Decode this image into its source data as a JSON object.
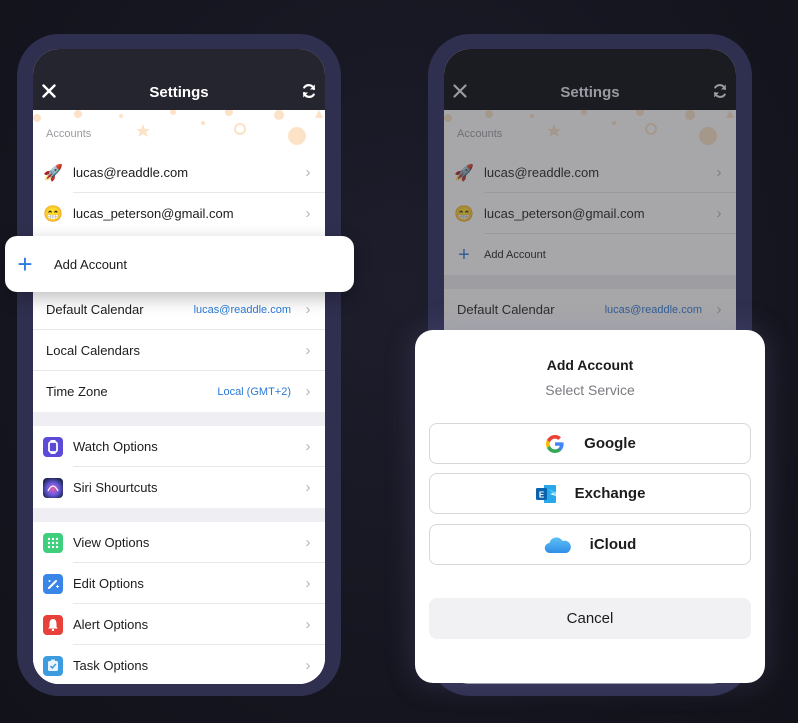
{
  "left_phone": {
    "nav": {
      "title": "Settings",
      "close_icon": "close-icon",
      "sync_icon": "sync-icon"
    },
    "accounts_section_label": "Accounts",
    "accounts": [
      {
        "icon": "rocket-emoji",
        "glyph": "🚀",
        "email": "lucas@readdle.com"
      },
      {
        "icon": "grinning-face-emoji",
        "glyph": "😁",
        "email": "lucas_peterson@gmail.com"
      }
    ],
    "add_account_card": {
      "label": "Add Account",
      "icon": "plus-icon"
    },
    "calendar_rows": [
      {
        "label": "Default Calendar",
        "value": "lucas@readdle.com"
      },
      {
        "label": "Local Calendars",
        "value": ""
      },
      {
        "label": "Time Zone",
        "value": "Local (GMT+2)"
      }
    ],
    "integrations": [
      {
        "label": "Watch Options",
        "icon": "watch-icon",
        "color": "#5b4bd6"
      },
      {
        "label": "Siri Shourtcuts",
        "icon": "siri-icon",
        "color": "#2a2f6b"
      }
    ],
    "options": [
      {
        "label": "View Options",
        "icon": "grid-icon",
        "color": "#3ecf7c"
      },
      {
        "label": "Edit Options",
        "icon": "pencil-icon",
        "color": "#3a86e8"
      },
      {
        "label": "Alert Options",
        "icon": "bell-icon",
        "color": "#e8403a"
      },
      {
        "label": "Task Options",
        "icon": "checklist-icon",
        "color": "#3d9be0"
      }
    ]
  },
  "right_phone": {
    "nav": {
      "title": "Settings"
    },
    "accounts_section_label": "Accounts",
    "accounts": [
      {
        "glyph": "🚀",
        "email": "lucas@readdle.com"
      },
      {
        "glyph": "😁",
        "email": "lucas_peterson@gmail.com"
      }
    ],
    "add_account_label": "Add Account",
    "default_calendar": {
      "label": "Default Calendar",
      "value": "lucas@readdle.com"
    }
  },
  "sheet": {
    "title": "Add Account",
    "subtitle": "Select Service",
    "services": [
      {
        "label": "Google",
        "icon": "google-icon"
      },
      {
        "label": "Exchange",
        "icon": "exchange-icon"
      },
      {
        "label": "iCloud",
        "icon": "icloud-icon"
      }
    ],
    "cancel_label": "Cancel"
  },
  "colors": {
    "accent": "#2d7be0",
    "frame": "#2f2f4f",
    "navbar": "#25252f"
  }
}
